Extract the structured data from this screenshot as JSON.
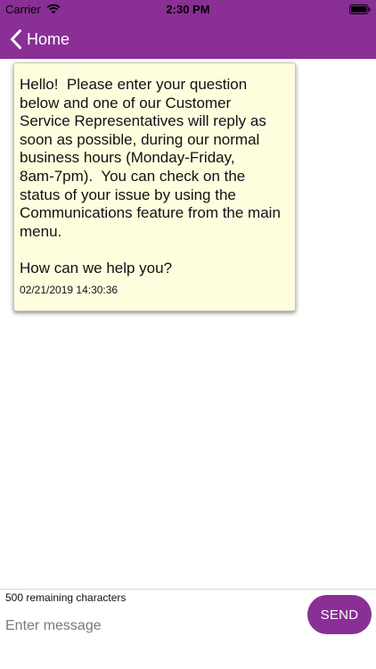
{
  "status_bar": {
    "carrier": "Carrier",
    "time": "2:30 PM"
  },
  "nav": {
    "back_label": "Home"
  },
  "message": {
    "text": "Hello!  Please enter your question\nbelow and one of our Customer\nService Representatives will reply as\nsoon as possible, during our normal\nbusiness hours (Monday-Friday,\n8am-7pm).  You can check on the\nstatus of your issue by using the\nCommunications feature from the main\nmenu.\n\nHow can we help you?",
    "timestamp": "02/21/2019 14:30:36"
  },
  "composer": {
    "remaining": "500 remaining characters",
    "placeholder": "Enter message",
    "send_label": "SEND"
  },
  "colors": {
    "brand": "#8a2f95",
    "bubble": "#fefedf"
  }
}
